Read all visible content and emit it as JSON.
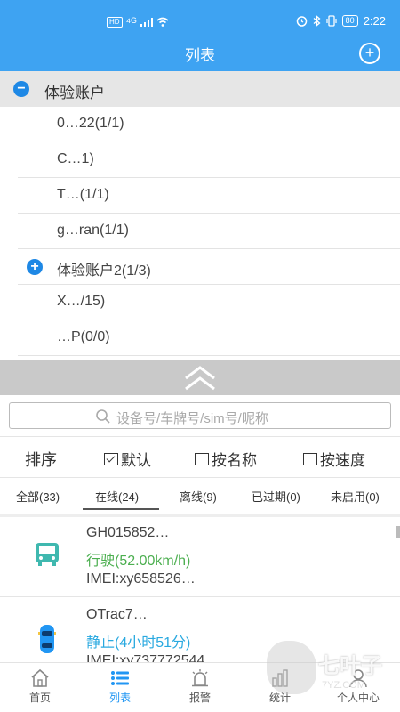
{
  "status_bar": {
    "time": "2:22",
    "hd_label": "HD",
    "network_label": "⁴ᴳ",
    "battery_label": "80"
  },
  "header": {
    "title": "列表"
  },
  "tree": {
    "root_group": {
      "label": "体验账户"
    },
    "items": [
      {
        "label": "0…22(1/1)"
      },
      {
        "label": "C…1)"
      },
      {
        "label": "T…(1/1)"
      },
      {
        "label": "g…ran(1/1)"
      },
      {
        "label": "体验账户2(1/3)"
      },
      {
        "label": "X…/15)"
      },
      {
        "label": "…P(0/0)"
      }
    ]
  },
  "search": {
    "placeholder": "设备号/车牌号/sim号/昵称"
  },
  "sort": {
    "title": "排序",
    "options": [
      {
        "label": "默认",
        "checked": true
      },
      {
        "label": "按名称",
        "checked": false
      },
      {
        "label": "按速度",
        "checked": false
      }
    ]
  },
  "tabs": [
    {
      "label": "全部(33)"
    },
    {
      "label": "在线(24)",
      "active": true
    },
    {
      "label": "离线(9)"
    },
    {
      "label": "已过期(0)"
    },
    {
      "label": "未启用(0)"
    }
  ],
  "vehicles": [
    {
      "name": "GH015852…",
      "status": "行驶(52.00km/h)",
      "status_color": "#4caf50",
      "imei": "IMEI:xy658526…",
      "icon": "bus-icon"
    },
    {
      "name": "OTrac7…",
      "status": "静止(4小时51分)",
      "status_color": "#29a9e0",
      "imei": "IMEI:xy737772544",
      "icon": "car-icon"
    }
  ],
  "bottom_nav": [
    {
      "label": "首页",
      "icon": "home-icon"
    },
    {
      "label": "列表",
      "icon": "list-icon",
      "active": true
    },
    {
      "label": "报警",
      "icon": "alarm-icon"
    },
    {
      "label": "统计",
      "icon": "chart-icon"
    },
    {
      "label": "个人中心",
      "icon": "user-icon"
    }
  ],
  "watermark": {
    "text": "七叶子",
    "sub": "7YZ.COM"
  },
  "colors": {
    "header": "#3ea3f2",
    "accent": "#2196f3",
    "moving": "#4caf50",
    "stopped": "#29a9e0"
  }
}
